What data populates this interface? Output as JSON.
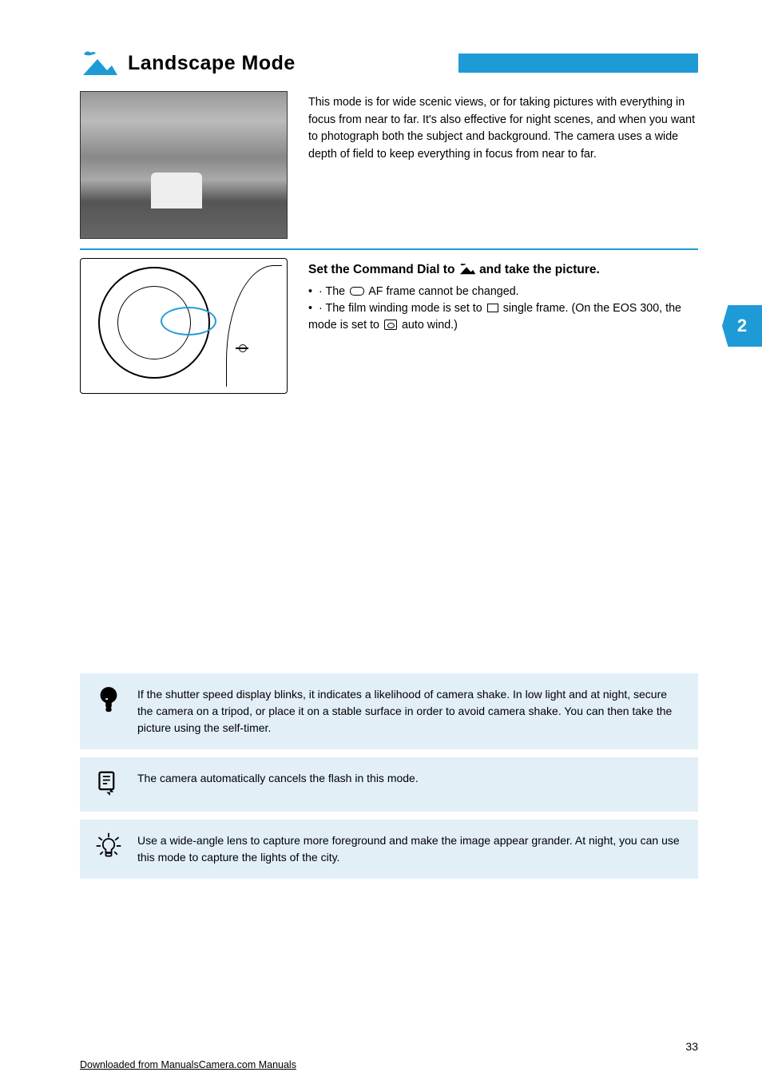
{
  "chapterTab": "2",
  "header": {
    "title": "Landscape Mode"
  },
  "intro": "This mode is for wide scenic views, or for taking pictures with everything in focus from near to far. It's also effective for night scenes, and when you want to photograph both the subject and background. The camera uses a wide depth of field to keep everything in focus from near to far.",
  "step": {
    "title_part1": "Set the Command Dial to ",
    "title_part2": " and take the picture.",
    "af_line": "· The ",
    "af_line2": "AF frame cannot be changed.",
    "drive_line": "· The film winding mode is set to ",
    "drive_line2": " single frame. (On the EOS 300, the mode is set to ",
    "drive_line3": " auto wind.)"
  },
  "notes": {
    "warning": "If the shutter speed display blinks, it indicates a likelihood of camera shake. In low light and at night, secure the camera on a tripod, or place it on a stable surface in order to avoid camera shake. You can then take the picture using the self-timer.",
    "info": "The camera automatically cancels the flash in this mode.",
    "tip": "Use a wide-angle lens to capture more foreground and make the image appear grander. At night, you can use this mode to capture the lights of the city."
  },
  "pageNumber": "33",
  "download": "Downloaded from ManualsCamera.com Manuals"
}
